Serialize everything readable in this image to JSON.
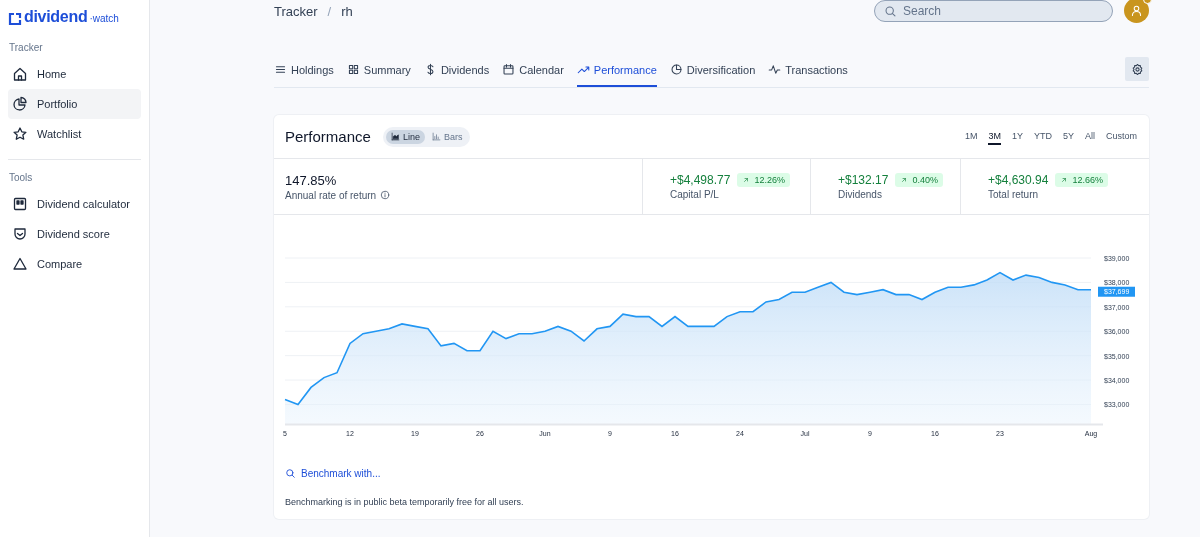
{
  "logo": {
    "name": "dividend",
    "suffix": "·watch"
  },
  "sidebar": {
    "sections": [
      {
        "title": "Tracker",
        "items": [
          {
            "label": "Home",
            "selected": false
          },
          {
            "label": "Portfolio",
            "selected": true
          },
          {
            "label": "Watchlist",
            "selected": false
          }
        ]
      },
      {
        "title": "Tools",
        "items": [
          {
            "label": "Dividend calculator",
            "selected": false
          },
          {
            "label": "Dividend score",
            "selected": false
          },
          {
            "label": "Compare",
            "selected": false
          }
        ]
      }
    ]
  },
  "breadcrumb": {
    "items": [
      "Tracker",
      "rh"
    ],
    "separator": "/"
  },
  "search": {
    "placeholder": "Search"
  },
  "tabs": [
    {
      "label": "Holdings",
      "selected": false
    },
    {
      "label": "Summary",
      "selected": false
    },
    {
      "label": "Dividends",
      "selected": false
    },
    {
      "label": "Calendar",
      "selected": false
    },
    {
      "label": "Performance",
      "selected": true
    },
    {
      "label": "Diversification",
      "selected": false
    },
    {
      "label": "Transactions",
      "selected": false
    }
  ],
  "card": {
    "title": "Performance",
    "views": [
      {
        "label": "Line",
        "selected": true
      },
      {
        "label": "Bars",
        "selected": false
      }
    ],
    "ranges": [
      {
        "label": "1M",
        "selected": false
      },
      {
        "label": "3M",
        "selected": true
      },
      {
        "label": "1Y",
        "selected": false
      },
      {
        "label": "YTD",
        "selected": false
      },
      {
        "label": "5Y",
        "selected": false
      },
      {
        "label": "All",
        "selected": false
      },
      {
        "label": "Custom",
        "selected": false
      }
    ],
    "summary": {
      "value": "147.85%",
      "label": "Annual rate of return"
    },
    "metrics": [
      {
        "value": "+$4,498.77",
        "change": "12.26%",
        "label": "Capital P/L"
      },
      {
        "value": "+$132.17",
        "change": "0.40%",
        "label": "Dividends"
      },
      {
        "value": "+$4,630.94",
        "change": "12.66%",
        "label": "Total return"
      }
    ],
    "chart_data": {
      "type": "area",
      "categories": [
        "5",
        null,
        null,
        null,
        null,
        "12",
        null,
        null,
        null,
        null,
        "19",
        null,
        null,
        null,
        null,
        "26",
        null,
        null,
        null,
        null,
        "Jun",
        null,
        null,
        null,
        null,
        "9",
        null,
        null,
        null,
        null,
        "16",
        null,
        null,
        null,
        null,
        "24",
        null,
        null,
        null,
        null,
        "Jul",
        null,
        null,
        null,
        null,
        "9",
        null,
        null,
        null,
        null,
        "16",
        null,
        null,
        null,
        null,
        "23",
        null,
        null,
        null,
        null,
        null,
        null,
        "Aug"
      ],
      "series": [
        {
          "color": "#2196f3",
          "values": [
            33200,
            33000,
            33700,
            34100,
            34300,
            35500,
            35900,
            36000,
            36100,
            36300,
            36200,
            36100,
            35400,
            35500,
            35200,
            35200,
            36000,
            35700,
            35900,
            35900,
            36000,
            36200,
            36000,
            35600,
            36100,
            36200,
            36700,
            36600,
            36600,
            36200,
            36600,
            36200,
            36200,
            36200,
            36600,
            36800,
            36800,
            37200,
            37300,
            37600,
            37600,
            37800,
            38000,
            37600,
            37500,
            37600,
            37700,
            37500,
            37500,
            37300,
            37600,
            37800,
            37800,
            37900,
            38100,
            38400,
            38100,
            38300,
            38200,
            38000,
            37900,
            37700,
            37700
          ]
        }
      ],
      "ylim": [
        32200,
        39000
      ],
      "grid": true,
      "yticks": [
        {
          "value": 33000,
          "label": "$33,000"
        },
        {
          "value": 34000,
          "label": "$34,000"
        },
        {
          "value": 35000,
          "label": "$35,000"
        },
        {
          "value": 36000,
          "label": "$36,000"
        },
        {
          "value": 37000,
          "label": "$37,000"
        },
        {
          "value": 38000,
          "label": "$38,000"
        },
        {
          "value": 39000,
          "label": "$39,000"
        }
      ],
      "annotations": [
        "$37,699"
      ]
    },
    "benchmark": "Benchmark with...",
    "note": "Benchmarking is in public beta temporarily free for all users."
  }
}
